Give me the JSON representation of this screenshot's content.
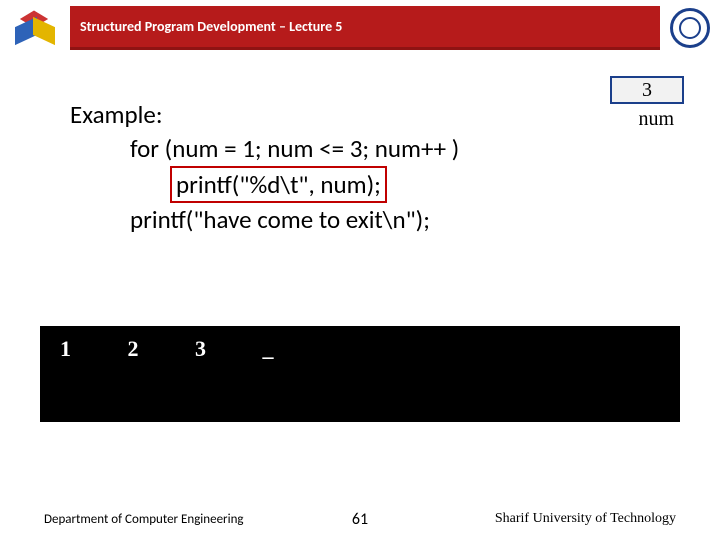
{
  "header": {
    "title": "Structured Program Development – Lecture 5"
  },
  "num_box": {
    "value": "3",
    "label": "num"
  },
  "example": {
    "heading": "Example:",
    "line_for": "for (num = 1; num <= 3; num++ )",
    "line_printf_boxed": "printf(\"%d\\t\", num);",
    "line_exit": "printf(\"have come to exit\\n\");"
  },
  "terminal": {
    "v1": "1",
    "v2": "2",
    "v3": "3",
    "cursor": "_"
  },
  "footer": {
    "dept": "Department of Computer Engineering",
    "page": "61",
    "university": "Sharif University of Technology"
  }
}
